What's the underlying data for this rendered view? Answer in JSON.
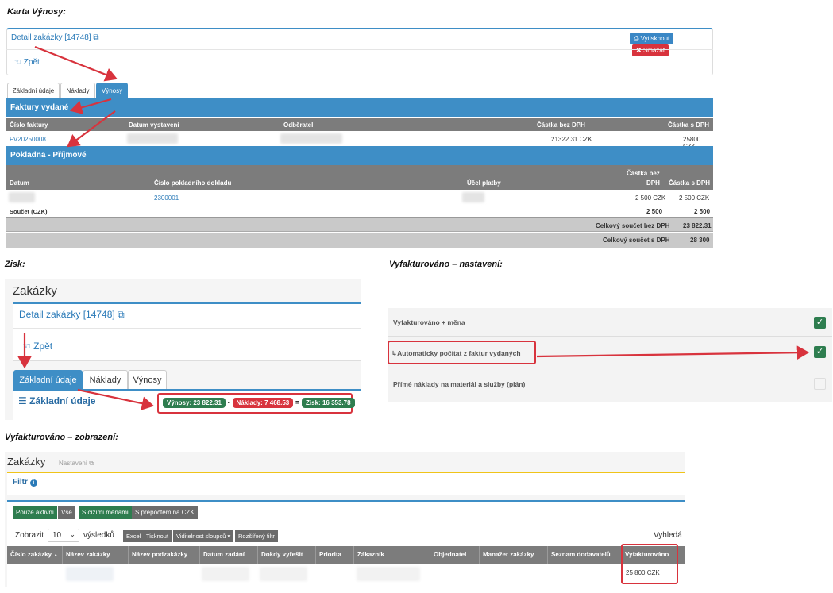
{
  "captions": {
    "karta": "Karta Výnosy:",
    "zisk": "Zisk:",
    "nastaveni": "Vyfakturováno – nastavení:",
    "zobrazeni": "Vyfakturováno – zobrazení:"
  },
  "s1": {
    "title": "Detail zakázky [14748]",
    "print_label": "Vytisknout",
    "delete_label": "Smazat",
    "back_label": "Zpět",
    "tabs": [
      "Základní údaje",
      "Náklady",
      "Výnosy"
    ],
    "invoices": {
      "header": "Faktury vydané",
      "columns": [
        "Číslo faktury",
        "Datum vystavení",
        "Odběratel",
        "Částka bez DPH",
        "Částka s DPH"
      ],
      "row": {
        "number": "FV20250008",
        "amount_net": "21322.31 CZK",
        "amount_gross": "25800 CZK"
      }
    },
    "cash": {
      "header": "Pokladna - Příjmové",
      "columns": [
        "Datum",
        "Číslo pokladního dokladu",
        "Účel platby",
        "Částka bez",
        "DPH",
        "Částka s DPH"
      ],
      "row": {
        "doc": "2300001",
        "net": "2 500 CZK",
        "gross": "2 500 CZK"
      },
      "sum_label": "Součet (CZK)",
      "sum_net": "2 500",
      "sum_gross": "2 500"
    },
    "totals": [
      {
        "label": "Celkový součet bez DPH",
        "value": "23 822.31"
      },
      {
        "label": "Celkový součet s DPH",
        "value": "28 300"
      }
    ]
  },
  "s2": {
    "header": "Zakázky",
    "title": "Detail zakázky [14748]",
    "back_label": "Zpět",
    "tabs": [
      "Základní údaje",
      "Náklady",
      "Výnosy"
    ],
    "section": "Základní údaje",
    "revenue": "Výnosy: 23 822.31",
    "minus": "-",
    "costs": "Náklady: 7 468.53",
    "equals": "=",
    "profit": "Zisk: 16 353.78"
  },
  "s3": {
    "rows": [
      {
        "label": "Vyfakturováno + měna",
        "checked": true
      },
      {
        "label": "Automaticky počítat z faktur vydaných",
        "checked": true
      },
      {
        "label": "Přímé náklady na materiál a služby (plán)",
        "checked": false
      }
    ]
  },
  "s4": {
    "header": "Zakázky",
    "settings": "Nastavení",
    "filter": "Filtr",
    "btn_active": "Pouze aktivní",
    "btn_all": "Vše",
    "btn_foreign": "S cizími měnami",
    "btn_conv": "S přepočtem na CZK",
    "show": "Zobrazit",
    "page_size": "10",
    "results": "výsledků",
    "dt_buttons": [
      "Excel",
      "Tisknout",
      "Viditelnost sloupců",
      "Rozšířený filtr"
    ],
    "search": "Vyhledá",
    "columns": [
      "Číslo zakázky",
      "Název zakázky",
      "Název podzakázky",
      "Datum zadání",
      "Dokdy vyřešit",
      "Priorita",
      "Zákazník",
      "Objednatel",
      "Manažer zakázky",
      "Seznam dodavatelů",
      "Vyfakturováno"
    ],
    "value": "25 800 CZK"
  },
  "colors": {
    "accent": "#3e8ec6",
    "success": "#2e7d4f",
    "danger": "#d8333d",
    "grey_header": "#7c7c7c"
  }
}
